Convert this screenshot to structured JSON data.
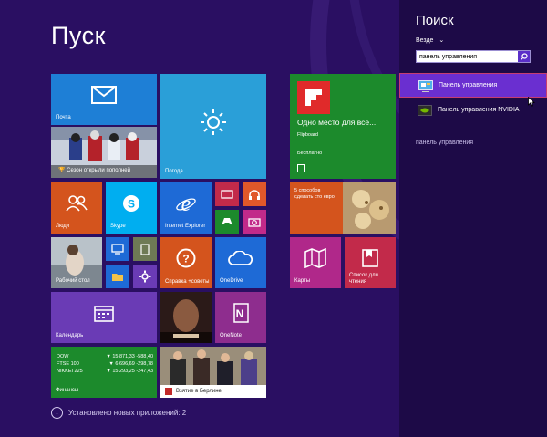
{
  "start": {
    "title": "Пуск",
    "installed_apps": "Установлено новых приложений: 2"
  },
  "tiles": {
    "mail": "Почта",
    "news": "Сезон открыли пополней",
    "weather": "Погода",
    "flipboard_headline": "Одно место для все...",
    "flipboard_name": "Flipboard",
    "flipboard_badge": "Бесплатно",
    "people": "Люди",
    "skype": "Skype",
    "ie": "Internet Explorer",
    "help": "Справка +советы",
    "onedrive": "OneDrive",
    "food": "5 способов сделать сто евро",
    "desktop": "Рабочий стол",
    "maps": "Карты",
    "reading": "Список для чтения",
    "calendar": "Календарь",
    "onenote": "OneNote",
    "finance_title": "Финансы",
    "finance_rows": [
      {
        "name": "DOW",
        "value": "▼ 15 871,33 -588,40"
      },
      {
        "name": "FTSE 100",
        "value": "▼ 6 696,69 -298,78"
      },
      {
        "name": "NIKKEI 225",
        "value": "▼ 15 293,25 -247,43"
      }
    ],
    "photo_news": "Взятие в Берлине"
  },
  "search": {
    "title": "Поиск",
    "scope": "Везде",
    "query": "панель управления",
    "results": [
      {
        "label": "Панель управления",
        "icon": "control-panel-icon"
      },
      {
        "label": "Панель управления NVIDIA",
        "icon": "nvidia-icon"
      }
    ],
    "suggestion": "панель управления"
  },
  "colors": {
    "background": "#2a0f62",
    "pane": "#1d0a47",
    "selected": "#6a2fd0",
    "selected_border": "#c63d6f"
  }
}
